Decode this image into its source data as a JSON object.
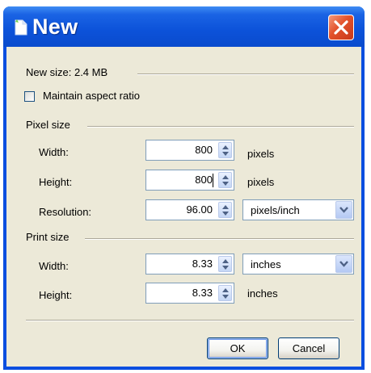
{
  "window": {
    "title": "New",
    "close_icon": "close-icon",
    "title_icon": "new-document-icon"
  },
  "new_size": {
    "label": "New size: 2.4 MB"
  },
  "maintain_aspect": {
    "label": "Maintain aspect ratio",
    "checked": false
  },
  "pixel_size": {
    "label": "Pixel size",
    "width": {
      "label": "Width:",
      "value": "800",
      "unit": "pixels"
    },
    "height": {
      "label": "Height:",
      "value": "800",
      "unit": "pixels"
    },
    "resolution": {
      "label": "Resolution:",
      "value": "96.00",
      "unit": "pixels/inch"
    }
  },
  "print_size": {
    "label": "Print size",
    "width": {
      "label": "Width:",
      "value": "8.33",
      "unit": "inches"
    },
    "height": {
      "label": "Height:",
      "value": "8.33",
      "unit": "inches"
    }
  },
  "buttons": {
    "ok": "OK",
    "cancel": "Cancel"
  },
  "colors": {
    "titlebar": "#0a4ee0",
    "close": "#e2512b",
    "dialog_bg": "#ece9d8"
  }
}
